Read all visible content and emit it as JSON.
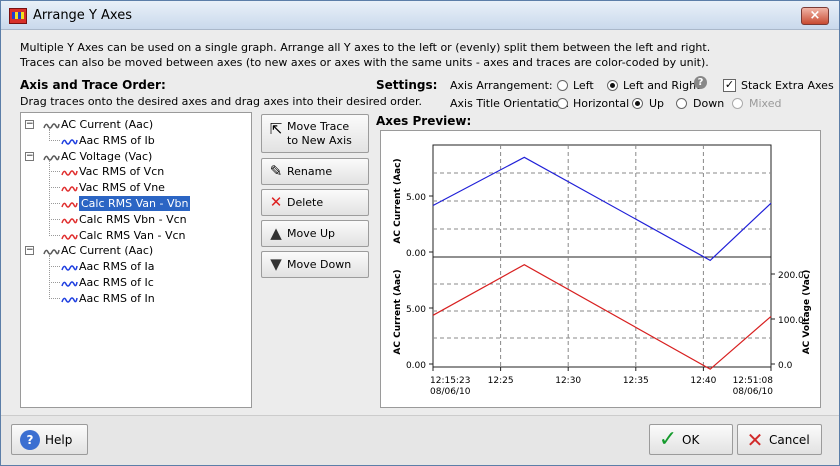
{
  "window": {
    "title": "Arrange Y Axes",
    "close_label": "×"
  },
  "description": {
    "line1": "Multiple Y Axes can be used on a single graph.  Arrange all Y axes to the left or (evenly) split them between the left and right.",
    "line2": "Traces can also be moved between axes (to new axes or axes with the same units - axes and traces are color-coded by unit)."
  },
  "axis_order": {
    "title": "Axis and Trace Order:",
    "hint": "Drag traces onto the desired axes and drag axes into their desired order."
  },
  "tree": {
    "axes": [
      {
        "label": "AC Current (Aac)",
        "color": "#5a5a5a",
        "traces": [
          {
            "label": "Aac RMS of Ib",
            "color": "#2040e0",
            "selected": false
          }
        ]
      },
      {
        "label": "AC Voltage (Vac)",
        "color": "#5a5a5a",
        "traces": [
          {
            "label": "Vac RMS of Vcn",
            "color": "#e03030",
            "selected": false
          },
          {
            "label": "Vac RMS of Vne",
            "color": "#e03030",
            "selected": false
          },
          {
            "label": "Calc RMS Van - Vbn",
            "color": "#e03030",
            "selected": true
          },
          {
            "label": "Calc RMS Vbn - Vcn",
            "color": "#e03030",
            "selected": false
          },
          {
            "label": "Calc RMS Van - Vcn",
            "color": "#e03030",
            "selected": false
          }
        ]
      },
      {
        "label": "AC Current (Aac)",
        "color": "#5a5a5a",
        "traces": [
          {
            "label": "Aac RMS of Ia",
            "color": "#2040e0",
            "selected": false
          },
          {
            "label": "Aac RMS of Ic",
            "color": "#2040e0",
            "selected": false
          },
          {
            "label": "Aac RMS of In",
            "color": "#2040e0",
            "selected": false
          }
        ]
      }
    ]
  },
  "buttons": {
    "move_trace_line1": "Move Trace",
    "move_trace_line2": "to New Axis",
    "rename": "Rename",
    "delete": "Delete",
    "move_up": "Move Up",
    "move_down": "Move Down"
  },
  "settings": {
    "label": "Settings:",
    "arrangement_label": "Axis Arrangement:",
    "left_label": "Left",
    "left_right_label": "Left and Right",
    "stack_label": "Stack Extra Axes",
    "orientation_label": "Axis Title Orientation:",
    "horizontal_label": "Horizontal",
    "up_label": "Up",
    "down_label": "Down",
    "mixed_label": "Mixed",
    "help_icon_label": "?"
  },
  "preview": {
    "title": "Axes Preview:"
  },
  "chart_data": [
    {
      "type": "line",
      "ylabel": "AC Current (Aac)",
      "y_ticks": [
        "5.00",
        "0.00"
      ],
      "series": [
        {
          "color": "#2020d8",
          "points": [
            [
              0,
              4.6
            ],
            [
              0.27,
              8.9
            ],
            [
              0.82,
              -0.3
            ],
            [
              1,
              4.8
            ]
          ]
        }
      ],
      "grid": true
    },
    {
      "type": "line",
      "ylabel": "AC Current (Aac)",
      "ylabel_right": "AC Voltage (Vac)",
      "y_ticks": [
        "5.00",
        "0.00"
      ],
      "y_ticks_right": [
        "200.0",
        "100.0",
        "0.0"
      ],
      "series": [
        {
          "color": "#d82020",
          "points": [
            [
              0,
              4.7
            ],
            [
              0.27,
              9.3
            ],
            [
              0.82,
              -0.2
            ],
            [
              1,
              4.6
            ]
          ]
        }
      ],
      "x_ticks": [
        {
          "label": "12:15:23",
          "sublabel": "08/06/10"
        },
        {
          "label": "12:25",
          "sublabel": ""
        },
        {
          "label": "12:30",
          "sublabel": ""
        },
        {
          "label": "12:35",
          "sublabel": ""
        },
        {
          "label": "12:40",
          "sublabel": ""
        },
        {
          "label": "12:51:08",
          "sublabel": "08/06/10"
        }
      ],
      "grid": true
    }
  ],
  "footer": {
    "help": "Help",
    "ok": "OK",
    "cancel": "Cancel"
  }
}
